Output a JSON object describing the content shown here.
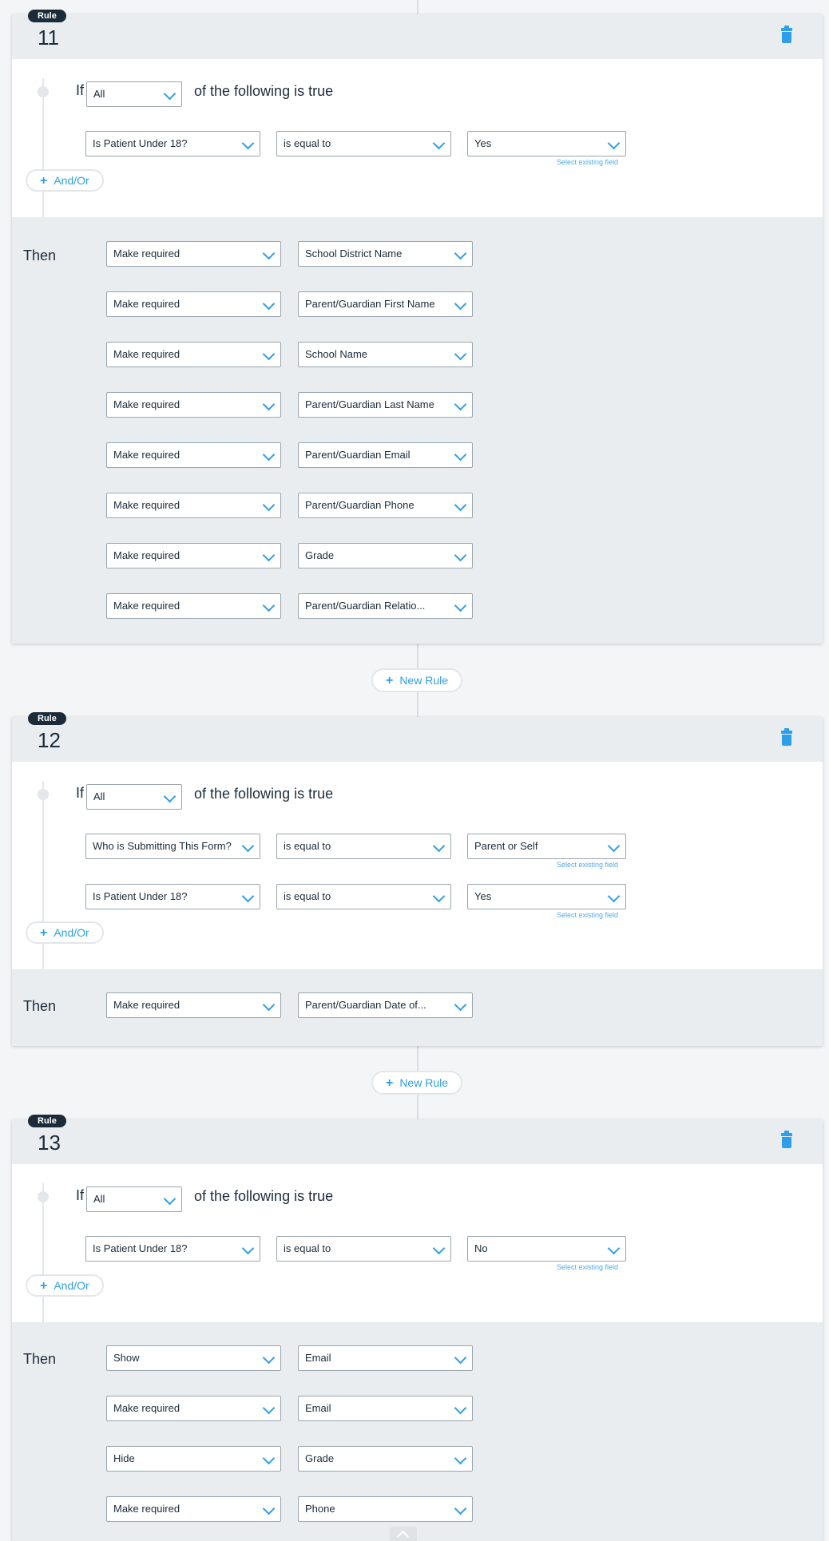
{
  "labels": {
    "rule_badge": "Rule",
    "if": "If",
    "following": "of the following is true",
    "then": "Then",
    "and_or": "And/Or",
    "new_rule": "New Rule",
    "select_existing": "Select existing field"
  },
  "rules": [
    {
      "number": "11",
      "match": "All",
      "conditions": [
        {
          "field": "Is Patient Under 18?",
          "operator": "is equal to",
          "value": "Yes"
        }
      ],
      "actions": [
        {
          "action": "Make required",
          "target": "School District Name"
        },
        {
          "action": "Make required",
          "target": "Parent/Guardian First Name"
        },
        {
          "action": "Make required",
          "target": "School Name"
        },
        {
          "action": "Make required",
          "target": "Parent/Guardian Last Name"
        },
        {
          "action": "Make required",
          "target": "Parent/Guardian Email"
        },
        {
          "action": "Make required",
          "target": "Parent/Guardian Phone"
        },
        {
          "action": "Make required",
          "target": "Grade"
        },
        {
          "action": "Make required",
          "target": "Parent/Guardian Relatio..."
        }
      ]
    },
    {
      "number": "12",
      "match": "All",
      "conditions": [
        {
          "field": "Who is Submitting This Form?",
          "operator": "is equal to",
          "value": "Parent or Self"
        },
        {
          "field": "Is Patient Under 18?",
          "operator": "is equal to",
          "value": "Yes"
        }
      ],
      "actions": [
        {
          "action": "Make required",
          "target": "Parent/Guardian Date of..."
        }
      ]
    },
    {
      "number": "13",
      "match": "All",
      "conditions": [
        {
          "field": "Is Patient Under 18?",
          "operator": "is equal to",
          "value": "No"
        }
      ],
      "actions": [
        {
          "action": "Show",
          "target": "Email"
        },
        {
          "action": "Make required",
          "target": "Email"
        },
        {
          "action": "Hide",
          "target": "Grade"
        },
        {
          "action": "Make required",
          "target": "Phone"
        }
      ]
    }
  ],
  "colors": {
    "accent": "#2f9ee8",
    "badge": "#1c2b3a",
    "panel": "#e9edf0"
  }
}
